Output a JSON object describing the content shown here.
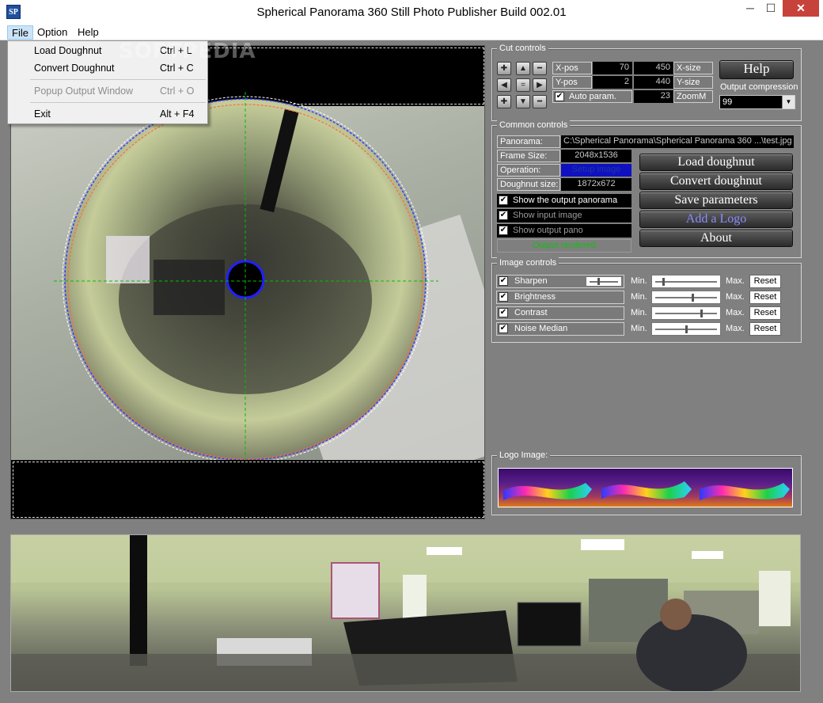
{
  "window": {
    "icon_text": "SP",
    "title": "Spherical Panorama 360 Still Photo Publisher  Build 002.01",
    "minimize": "─",
    "maximize": "☐",
    "close": "✕"
  },
  "menu": {
    "file": "File",
    "option": "Option",
    "help": "Help"
  },
  "file_menu": {
    "items": [
      {
        "label": "Load Doughnut",
        "shortcut": "Ctrl + L"
      },
      {
        "label": "Convert Doughnut",
        "shortcut": "Ctrl + C"
      },
      {
        "label": "Popup Output Window",
        "shortcut": "Ctrl + O"
      },
      {
        "label": "Exit",
        "shortcut": "Alt + F4"
      }
    ]
  },
  "watermark": "SOFTPEDIA",
  "cut_controls": {
    "title": "Cut controls",
    "xpos_label": "X-pos",
    "xpos_value": "70",
    "xsize_value": "450",
    "xsize_label": "X-size",
    "ypos_label": "Y-pos",
    "ypos_value": "2",
    "ysize_value": "440",
    "ysize_label": "Y-size",
    "auto_param_label": "Auto param.",
    "zoom_value": "23",
    "zoom_label": "ZoomM",
    "help_button": "Help",
    "output_compression_label": "Output compression",
    "output_compression_value": "99"
  },
  "common_controls": {
    "title": "Common controls",
    "panorama_label": "Panorama:",
    "panorama_value": "C:\\Spherical Panorama\\Spherical Panorama 360 ...\\test.jpg",
    "frame_size_label": "Frame Size:",
    "frame_size_value": "2048x1536",
    "operation_label": "Operation:",
    "operation_value": "Setup image",
    "doughnut_size_label": "Doughnut size:",
    "doughnut_size_value": "1872x672",
    "show_output_panorama": "Show the output panorama",
    "show_input_image": "Show input image",
    "show_output_pano": "Show output pano",
    "status": "Output rendered",
    "load_doughnut_button": "Load doughnut",
    "convert_doughnut_button": "Convert doughnut",
    "save_parameters_button": "Save parameters",
    "add_logo_button": "Add a Logo",
    "about_button": "About"
  },
  "image_controls": {
    "title": "Image controls",
    "min_label": "Min.",
    "max_label": "Max.",
    "reset_label": "Reset",
    "rows": [
      {
        "label": "Sharpen",
        "value": 0.12
      },
      {
        "label": "Brightness",
        "value": 0.6
      },
      {
        "label": "Contrast",
        "value": 0.75
      },
      {
        "label": "Noise Median",
        "value": 0.5
      }
    ]
  },
  "logo_image": {
    "title": "Logo Image:"
  }
}
